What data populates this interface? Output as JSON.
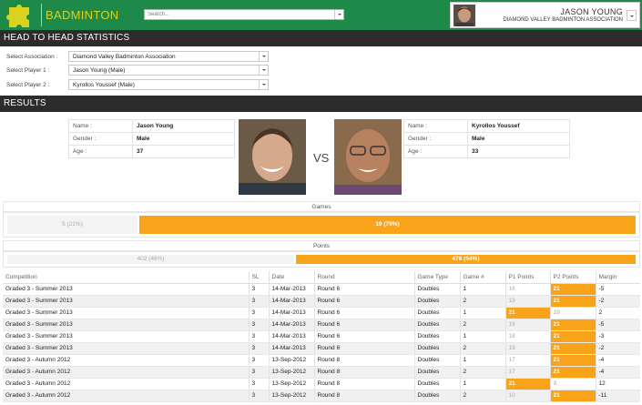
{
  "header": {
    "brand": "BADMINTON",
    "search_placeholder": "Search...",
    "user_name": "JASON YOUNG",
    "user_association": "DIAMOND VALLEY BADMINTON ASSOCIATION"
  },
  "h2h": {
    "title": "HEAD TO HEAD STATISTICS",
    "association_label": "Select Association :",
    "association_value": "Diamond Valley Badminton Association",
    "player1_label": "Select Player 1 :",
    "player1_value": "Jason Young (Male)",
    "player2_label": "Select Player 2 :",
    "player2_value": "Kyrollos Youssef (Male)"
  },
  "results_title": "RESULTS",
  "player1": {
    "name_label": "Name :",
    "name": "Jason Young",
    "gender_label": "Gender :",
    "gender": "Male",
    "age_label": "Age :",
    "age": "37"
  },
  "player2": {
    "name_label": "Name :",
    "name": "Kyrollos Youssef",
    "gender_label": "Gender :",
    "gender": "Male",
    "age_label": "Age :",
    "age": "33"
  },
  "vs_label": "VS",
  "games": {
    "title": "Games",
    "left_label": "5 (21%)",
    "right_label": "19 (79%)",
    "left_share": 0.21
  },
  "points": {
    "title": "Points",
    "left_label": "402 (46%)",
    "right_label": "478 (54%)",
    "left_share": 0.46
  },
  "table": {
    "headers": [
      "Competition",
      "SL",
      "Date",
      "Round",
      "Game Type",
      "Game #",
      "P1 Points",
      "P2 Points",
      "Margin"
    ],
    "rows": [
      [
        "Graded 3 - Summer 2013",
        "3",
        "14-Mar-2013",
        "Round 6",
        "Doubles",
        "1",
        "16",
        "21",
        "-5"
      ],
      [
        "Graded 3 - Summer 2013",
        "3",
        "14-Mar-2013",
        "Round 6",
        "Doubles",
        "2",
        "19",
        "21",
        "-2"
      ],
      [
        "Graded 3 - Summer 2013",
        "3",
        "14-Mar-2013",
        "Round 6",
        "Doubles",
        "1",
        "21",
        "19",
        "2"
      ],
      [
        "Graded 3 - Summer 2013",
        "3",
        "14-Mar-2013",
        "Round 6",
        "Doubles",
        "2",
        "16",
        "21",
        "-5"
      ],
      [
        "Graded 3 - Summer 2013",
        "3",
        "14-Mar-2013",
        "Round 6",
        "Doubles",
        "1",
        "18",
        "21",
        "-3"
      ],
      [
        "Graded 3 - Summer 2013",
        "3",
        "14-Mar-2013",
        "Round 6",
        "Doubles",
        "2",
        "19",
        "21",
        "-2"
      ],
      [
        "Graded 3 - Autumn 2012",
        "3",
        "13-Sep-2012",
        "Round 8",
        "Doubles",
        "1",
        "17",
        "21",
        "-4"
      ],
      [
        "Graded 3 - Autumn 2012",
        "3",
        "13-Sep-2012",
        "Round 8",
        "Doubles",
        "2",
        "17",
        "21",
        "-4"
      ],
      [
        "Graded 3 - Autumn 2012",
        "3",
        "13-Sep-2012",
        "Round 8",
        "Doubles",
        "1",
        "21",
        "9",
        "12"
      ],
      [
        "Graded 3 - Autumn 2012",
        "3",
        "13-Sep-2012",
        "Round 8",
        "Doubles",
        "2",
        "10",
        "21",
        "-11"
      ]
    ]
  },
  "colors": {
    "brand_green": "#1e8a4a",
    "accent_orange": "#f9a31a",
    "section_dark": "#2c2c2c"
  }
}
